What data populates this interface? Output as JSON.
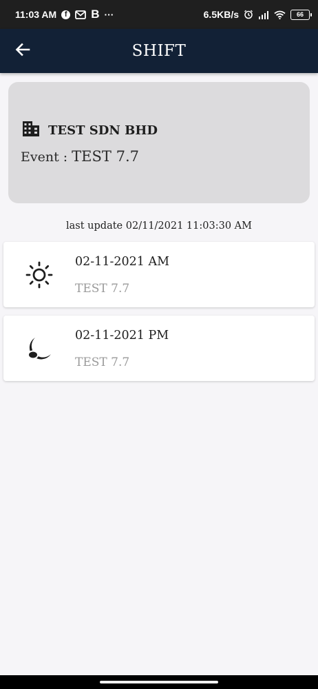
{
  "status_bar": {
    "time": "11:03 AM",
    "dots": "···",
    "b_letter": "B",
    "speed": "6.5KB/s",
    "battery": "66"
  },
  "app_bar": {
    "title": "SHIFT"
  },
  "company": {
    "name": "TEST SDN BHD",
    "event_label": "Event :",
    "event_value": "TEST 7.7"
  },
  "last_update": "last update 02/11/2021 11:03:30 AM",
  "shifts": [
    {
      "date": "02-11-2021 AM",
      "event": "TEST 7.7",
      "icon": "sun-icon"
    },
    {
      "date": "02-11-2021 PM",
      "event": "TEST 7.7",
      "icon": "moon-icon"
    }
  ]
}
